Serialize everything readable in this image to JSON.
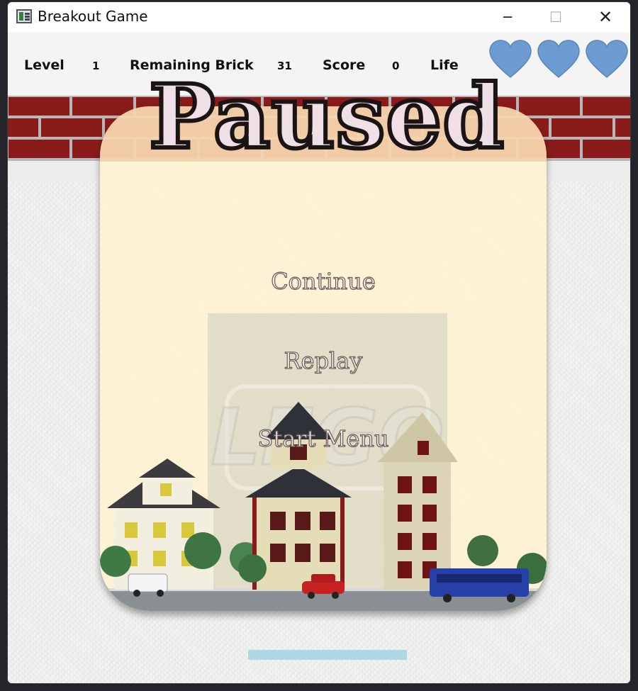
{
  "window": {
    "title": "Breakout Game",
    "minimize_glyph": "─",
    "maximize_glyph": "☐",
    "close_glyph": "✕"
  },
  "hud": {
    "level_label": "Level",
    "level_value": "1",
    "bricks_label": "Remaining Brick",
    "bricks_value": "31",
    "score_label": "Score",
    "score_value": "0",
    "life_label": "Life",
    "lives": 3,
    "heart_color": "#6b9bd1"
  },
  "bricks": {
    "color": "#8b1b1b",
    "mortar": "#b8b8b8"
  },
  "pause_menu": {
    "title": "Paused",
    "items": [
      {
        "label": "Continue"
      },
      {
        "label": "Replay"
      },
      {
        "label": "Start Menu"
      }
    ]
  },
  "paddle": {
    "color": "#add8e6"
  }
}
